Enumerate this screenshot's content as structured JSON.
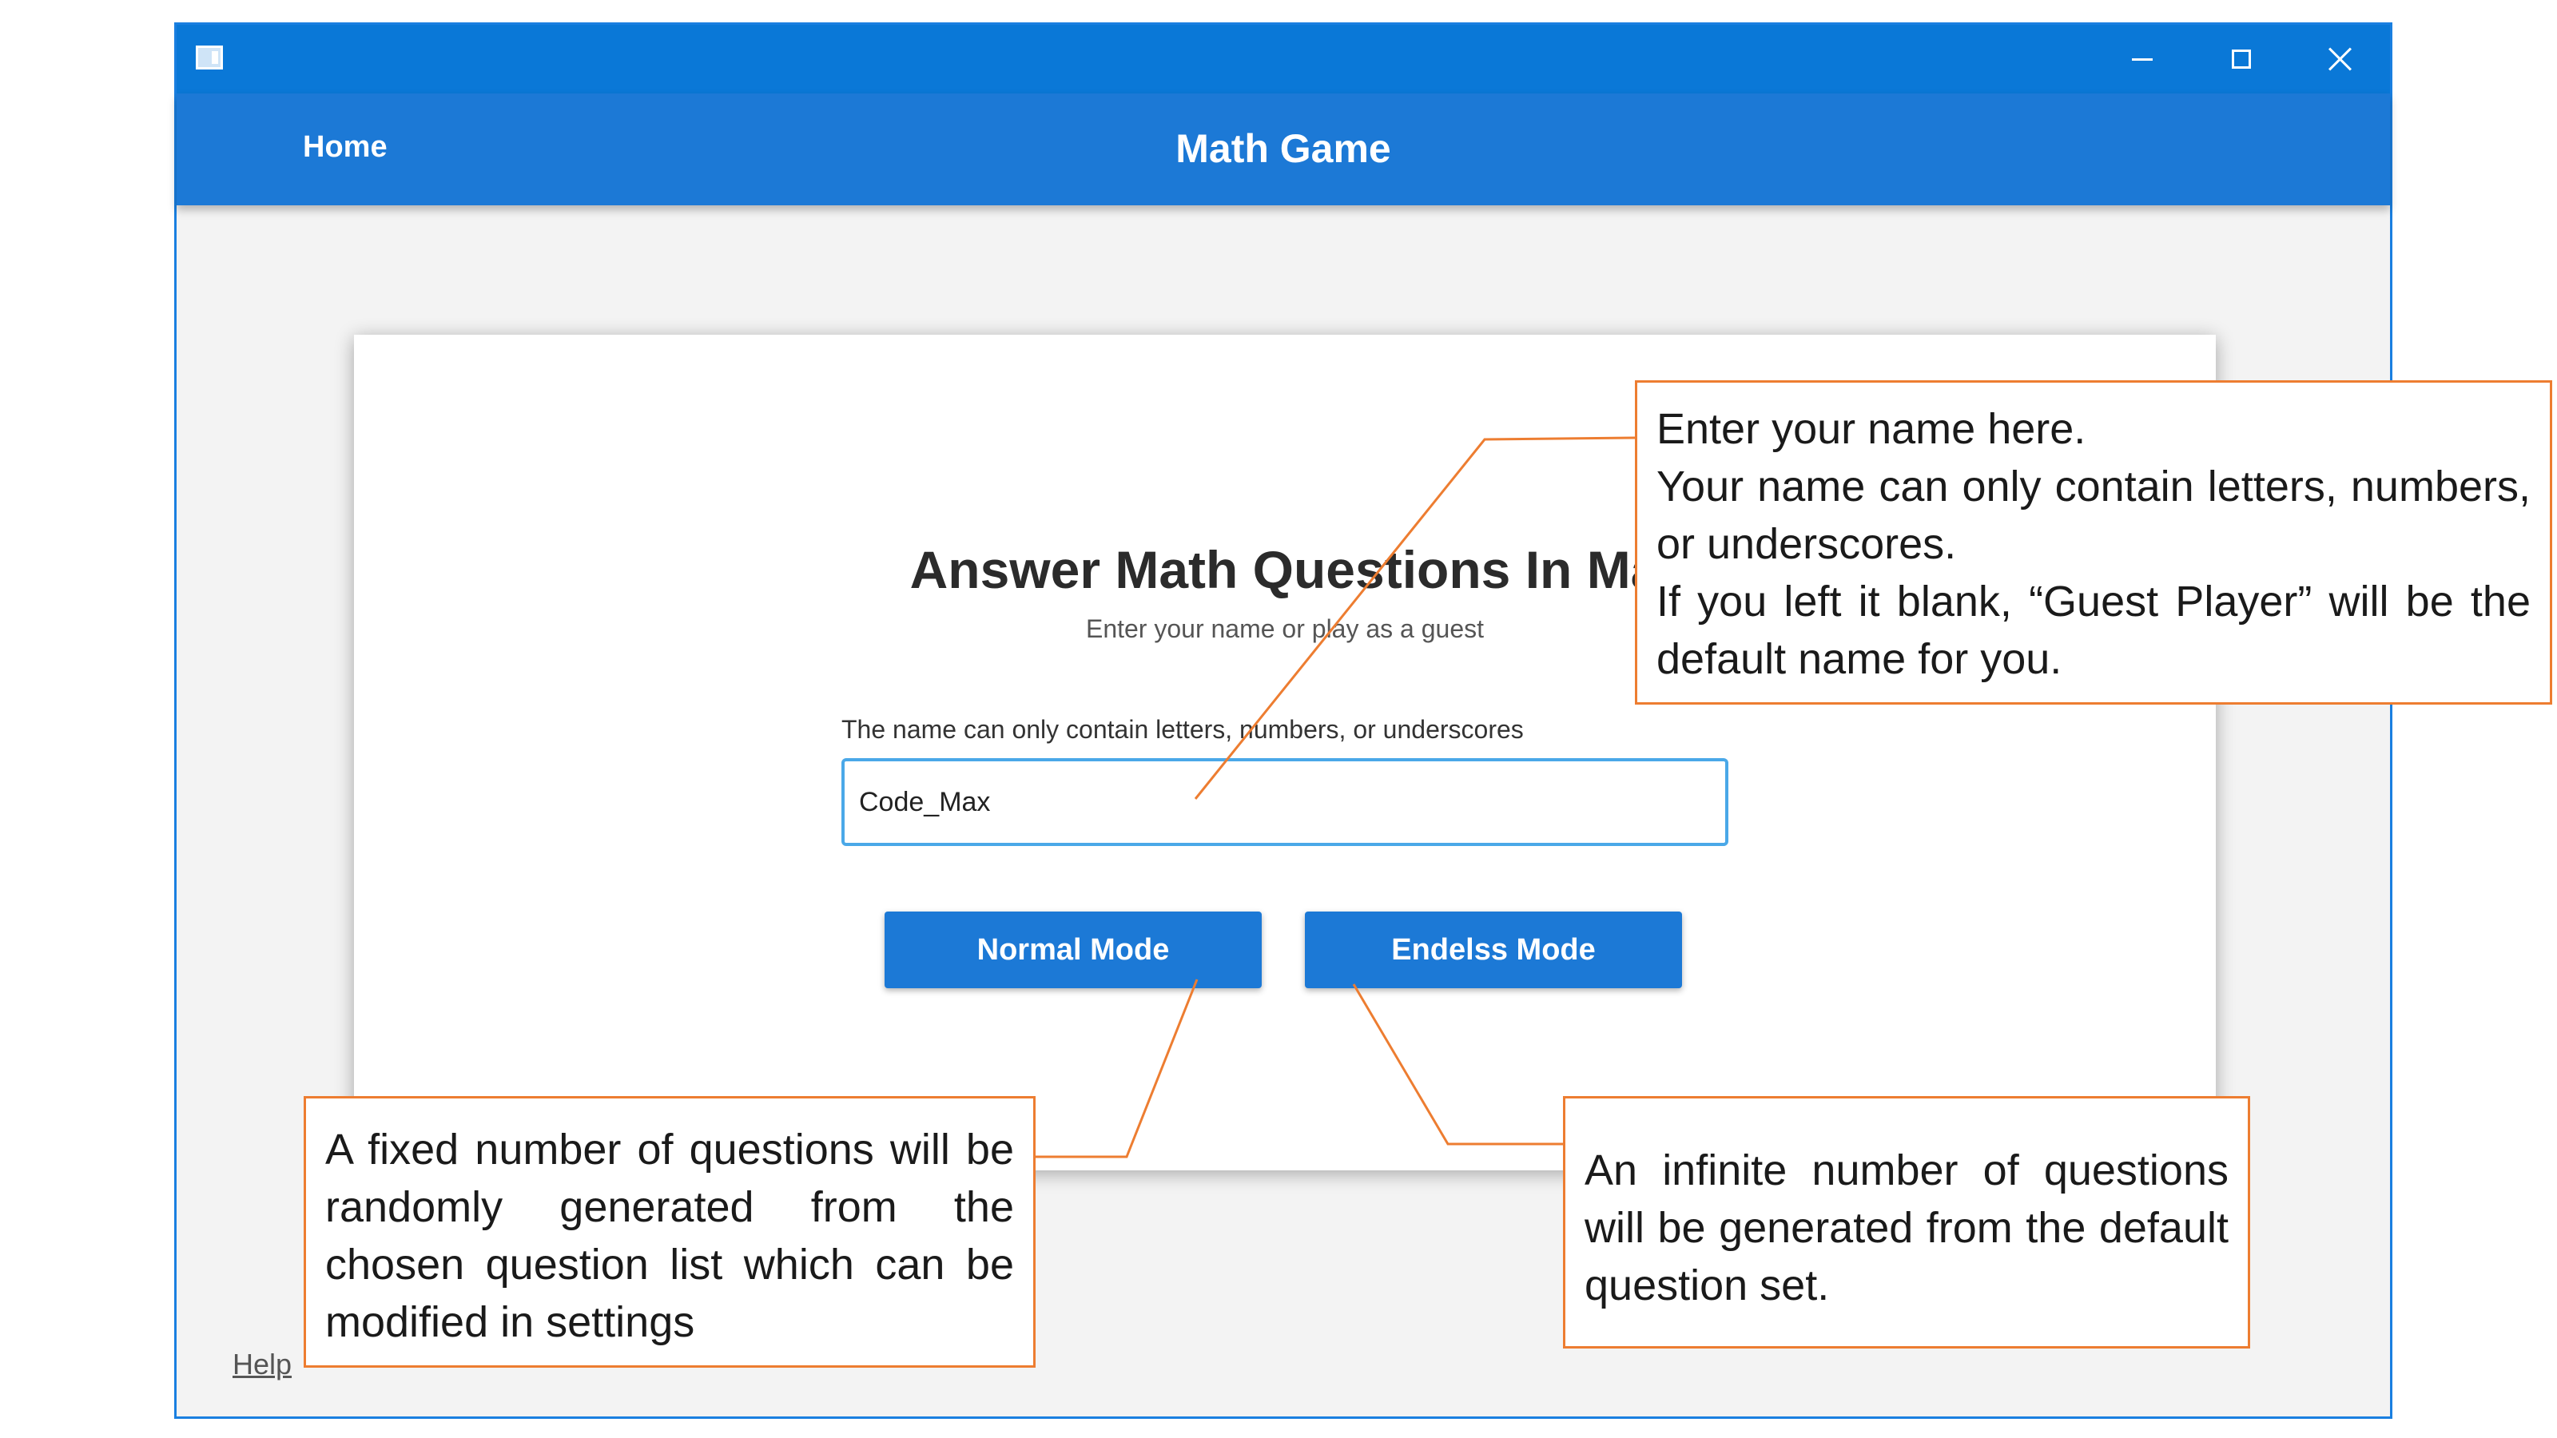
{
  "window": {
    "title": "Math Game",
    "controls": {
      "minimize": "minimize",
      "maximize": "maximize",
      "close": "close"
    }
  },
  "appbar": {
    "home_label": "Home",
    "title": "Math Game"
  },
  "card": {
    "heading": "Answer Math Questions In Ma",
    "subtitle": "Enter your name or play as a guest",
    "field_hint": "The name can only contain letters, numbers, or underscores",
    "name_value": "Code_Max",
    "normal_label": "Normal Mode",
    "endless_label": "Endelss Mode"
  },
  "help_label": "Help",
  "callouts": {
    "name": [
      "Enter your name here.",
      "Your name can only contain letters, numbers, or underscores.",
      "If you left it blank, “Guest Player” will be the default name for you."
    ],
    "normal": "A fixed number of questions will be randomly generated from the chosen question list which can be modified in settings",
    "endless": "An infinite number of questions will be generated from the default question set."
  },
  "colors": {
    "accent": "#1c79d6",
    "titlebar": "#0a78d7",
    "callout_border": "#ed7d31"
  }
}
